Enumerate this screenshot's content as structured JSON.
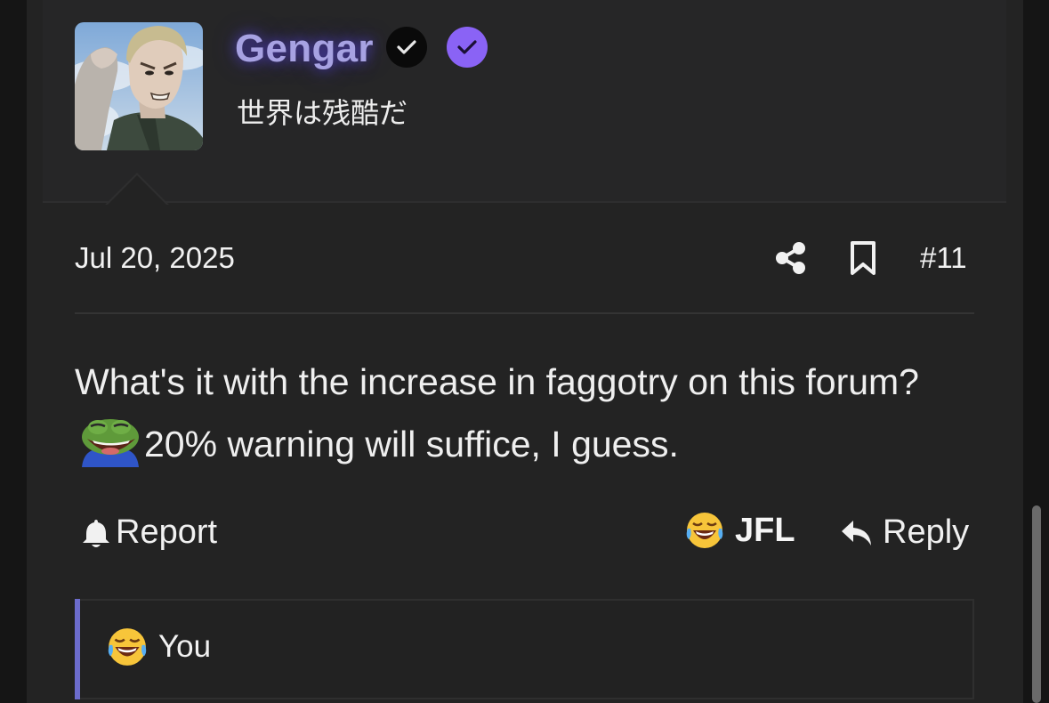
{
  "user": {
    "name": "Gengar",
    "title": "世界は残酷だ",
    "name_glow_color": "#5846dc",
    "badges": [
      {
        "icon": "check-icon",
        "color": "#0a0a0a"
      },
      {
        "icon": "check-icon",
        "color": "#8a63f5"
      }
    ]
  },
  "post": {
    "date": "Jul 20, 2025",
    "number": "#11",
    "body_part1": "What's it with the increase in faggotry on this forum?",
    "body_emoji": "pepe-laugh-emoji",
    "body_part2": "20% warning will suffice, I guess."
  },
  "actions": {
    "report_label": "Report",
    "reaction_label": "JFL",
    "reaction_emoji": "crying-laughing-emoji",
    "reply_label": "Reply"
  },
  "reactions_summary": {
    "emoji": "crying-laughing-emoji",
    "text": "You"
  },
  "colors": {
    "accent": "#6c6ccc",
    "background": "#232323",
    "username": "#a7a2e2"
  }
}
